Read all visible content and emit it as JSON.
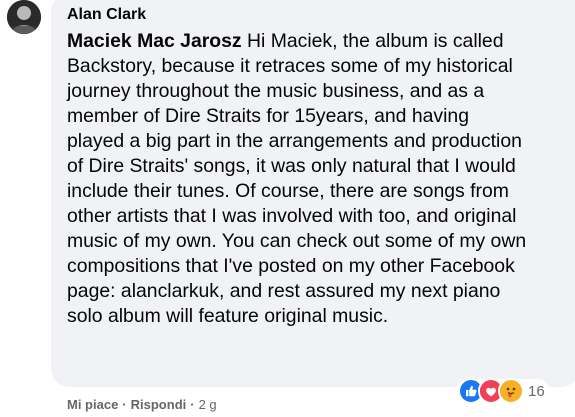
{
  "comment": {
    "author": "Alan Clark",
    "mention": "Maciek Mac Jarosz",
    "body": " Hi Maciek, the album is called Backstory, because it retraces some of my historical journey throughout the music business, and as a member of Dire Straits for 15years, and having played a big part in the arrangements and production of Dire Straits' songs, it was only natural that I would include their tunes. Of course, there are songs from other artists that I was involved with too, and original music of my own. You can check out some of my own compositions that I've posted on my other Facebook page: alanclarkuk, and rest assured my next piano solo album will feature original music."
  },
  "reactions": {
    "count": "16",
    "icons": [
      "like-icon",
      "love-icon",
      "care-icon"
    ],
    "colors": {
      "like": "#1877f2",
      "love": "#f33e58",
      "care": "#f7b125"
    }
  },
  "actions": {
    "like_label": "Mi piace",
    "separator": "·",
    "reply_label": "Rispondi",
    "timestamp": "2 g"
  }
}
